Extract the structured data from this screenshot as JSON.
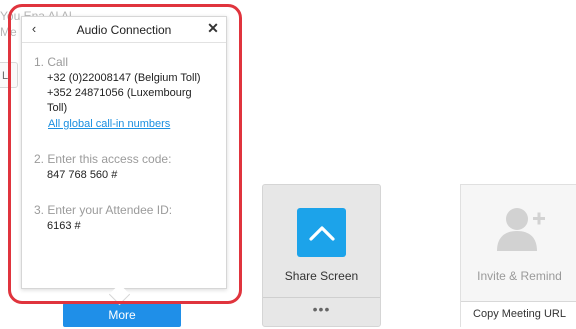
{
  "background": {
    "line1": "You Ena Al Al",
    "line2": "Me",
    "pill_label": "L"
  },
  "popup": {
    "title": "Audio Connection",
    "back_icon": "chevron-left-icon",
    "close_icon": "close-icon",
    "steps": [
      {
        "heading": "1. Call",
        "lines": [
          "+32 (0)22008147 (Belgium Toll)",
          "+352 24871056 (Luxembourg",
          "Toll)"
        ],
        "link": "All global call-in numbers"
      },
      {
        "heading": "2. Enter this access code:",
        "lines": [
          "847 768 560 #"
        ]
      },
      {
        "heading": "3. Enter your Attendee ID:",
        "lines": [
          "6163 #"
        ]
      }
    ]
  },
  "buttons": {
    "more_label": "More"
  },
  "tiles": {
    "share": {
      "label": "Share Screen",
      "icon": "chevron-up-icon",
      "more_dots": "•••",
      "accent": "#1ca3ea"
    },
    "invite": {
      "label": "Invite & Remind",
      "icon": "add-person-icon",
      "copy_label": "Copy Meeting URL"
    }
  },
  "colors": {
    "highlight": "#e0343d",
    "more_button": "#1f8fe8",
    "link": "#1a8fe0"
  }
}
